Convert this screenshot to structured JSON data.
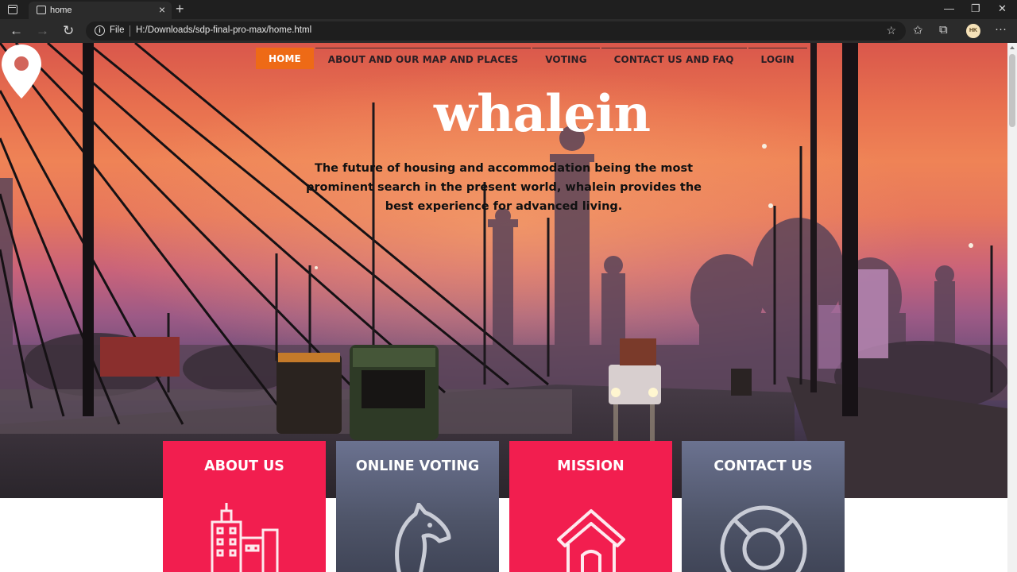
{
  "browser": {
    "tab_title": "home",
    "file_label": "File",
    "url": "H:/Downloads/sdp-final-pro-max/home.html",
    "profile_initials": "HK"
  },
  "nav": {
    "home": "HOME",
    "about": "ABOUT AND OUR MAP AND PLACES",
    "voting": "VOTING",
    "contact": "CONTACT US AND FAQ",
    "login": "LOGIN"
  },
  "hero": {
    "brand": "whalein",
    "tagline": "The future of housing and accommodation being the most prominent search in the present world, whalein provides the best experience for advanced living."
  },
  "cards": [
    {
      "title": "ABOUT US",
      "icon": "city-icon",
      "color": "#f21e4f"
    },
    {
      "title": "ONLINE VOTING",
      "icon": "chess-knight-icon",
      "color": "#5a6078"
    },
    {
      "title": "MISSION",
      "icon": "house-icon",
      "color": "#f21e4f"
    },
    {
      "title": "CONTACT US",
      "icon": "lifebuoy-icon",
      "color": "#5a6078"
    }
  ],
  "colors": {
    "nav_active": "#ee6a16",
    "card_pink": "#f21e4f",
    "card_slate": "#5a6078"
  }
}
